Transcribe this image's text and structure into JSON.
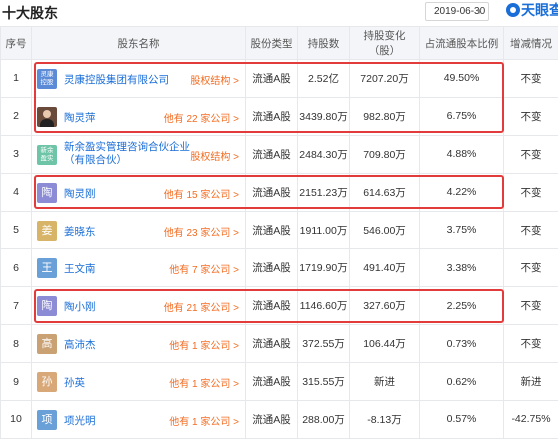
{
  "header": {
    "title": "十大股东",
    "date": "2019-06-30",
    "brand": "天眼查"
  },
  "columns": [
    "序号",
    "股东名称",
    "股份类型",
    "持股数",
    "持股变化（股）",
    "占流通股本比例",
    "增减情况"
  ],
  "rows": [
    {
      "no": "1",
      "avatar": "灵康\n控股",
      "avatar_color": "#5b8bd6",
      "name": "灵康控股集团有限公司",
      "extra": "股权结构 >",
      "type": "流通A股",
      "shares": "2.52亿",
      "change": "7207.20万",
      "ratio": "49.50%",
      "status": "不变"
    },
    {
      "no": "2",
      "avatar": "",
      "avatar_color": "#6a4a3a",
      "name": "陶灵萍",
      "extra": "他有 22 家公司 >",
      "type": "流通A股",
      "shares": "3439.80万",
      "change": "982.80万",
      "ratio": "6.75%",
      "status": "不变"
    },
    {
      "no": "3",
      "avatar": "新余\n盈实",
      "avatar_color": "#6ec4a6",
      "name": "新余盈实管理咨询合伙企业（有限合伙）",
      "extra": "股权结构 >",
      "type": "流通A股",
      "shares": "2484.30万",
      "change": "709.80万",
      "ratio": "4.88%",
      "status": "不变"
    },
    {
      "no": "4",
      "avatar": "陶",
      "avatar_color": "#8b8bd6",
      "name": "陶灵刚",
      "extra": "他有 15 家公司 >",
      "type": "流通A股",
      "shares": "2151.23万",
      "change": "614.63万",
      "ratio": "4.22%",
      "status": "不变"
    },
    {
      "no": "5",
      "avatar": "姜",
      "avatar_color": "#d7b468",
      "name": "姜晓东",
      "extra": "他有 23 家公司 >",
      "type": "流通A股",
      "shares": "1911.00万",
      "change": "546.00万",
      "ratio": "3.75%",
      "status": "不变"
    },
    {
      "no": "6",
      "avatar": "王",
      "avatar_color": "#6aa0d8",
      "name": "王文南",
      "extra": "他有 7 家公司 >",
      "type": "流通A股",
      "shares": "1719.90万",
      "change": "491.40万",
      "ratio": "3.38%",
      "status": "不变"
    },
    {
      "no": "7",
      "avatar": "陶",
      "avatar_color": "#8b8bd6",
      "name": "陶小刚",
      "extra": "他有 21 家公司 >",
      "type": "流通A股",
      "shares": "1146.60万",
      "change": "327.60万",
      "ratio": "2.25%",
      "status": "不变"
    },
    {
      "no": "8",
      "avatar": "高",
      "avatar_color": "#c9a173",
      "name": "高沛杰",
      "extra": "他有 1 家公司 >",
      "type": "流通A股",
      "shares": "372.55万",
      "change": "106.44万",
      "ratio": "0.73%",
      "status": "不变"
    },
    {
      "no": "9",
      "avatar": "孙",
      "avatar_color": "#d8a878",
      "name": "孙英",
      "extra": "他有 1 家公司 >",
      "type": "流通A股",
      "shares": "315.55万",
      "change": "新进",
      "ratio": "0.62%",
      "status": "新进"
    },
    {
      "no": "10",
      "avatar": "项",
      "avatar_color": "#6aa0d8",
      "name": "项光明",
      "extra": "他有 1 家公司 >",
      "type": "流通A股",
      "shares": "288.00万",
      "change": "-8.13万",
      "ratio": "0.57%",
      "status": "-42.75%"
    }
  ],
  "highlight_rows": [
    [
      1,
      2
    ],
    [
      4,
      4
    ],
    [
      7,
      7
    ]
  ],
  "colors": {
    "link": "#1a6ed8",
    "accent": "#f36c21",
    "highlight": "#e23b3b"
  }
}
